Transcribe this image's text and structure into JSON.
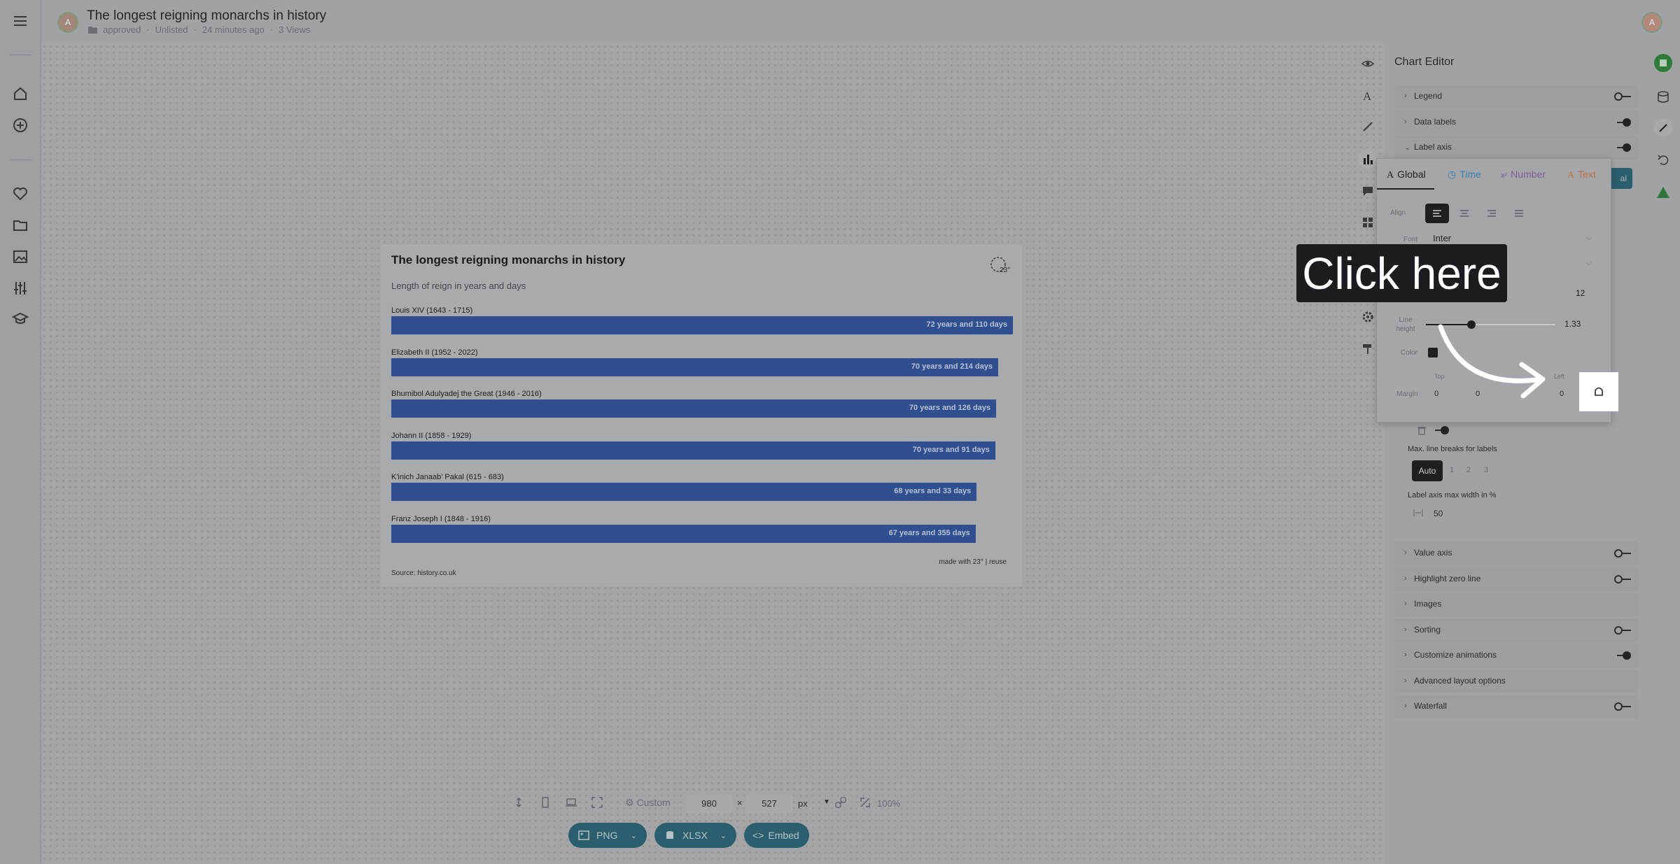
{
  "header": {
    "title": "The longest reigning monarchs in history",
    "folder": "approved",
    "visibility": "Unlisted",
    "updated": "24 minutes ago",
    "views": "3 Views",
    "avatar_letter": "A"
  },
  "chart": {
    "title": "The longest reigning monarchs in history",
    "subtitle": "Length of reign in years and days",
    "source": "Source: history.co.uk",
    "made_with": "made with 23° | reuse",
    "logo_text": "23°"
  },
  "chart_data": {
    "type": "bar",
    "orientation": "horizontal",
    "categories": [
      "Louis XIV (1643 - 1715)",
      "Elizabeth II (1952 - 2022)",
      "Bhumibol Adulyadej the Great (1946 - 2016)",
      "Johann II (1858 - 1929)",
      "K'inich Janaab' Pakal (615 - 683)",
      "Franz Joseph I (1848 - 1916)"
    ],
    "values": [
      72.3,
      70.59,
      70.35,
      70.25,
      68.09,
      67.97
    ],
    "data_labels": [
      "72 years and 110 days",
      "70 years and 214 days",
      "70 years and 126 days",
      "70 years and 91 days",
      "68 years and 33 days",
      "67 years and 355 days"
    ],
    "title": "The longest reigning monarchs in history",
    "subtitle": "Length of reign in years and days",
    "bar_color": "#2f4f8f",
    "grid": false,
    "legend": false
  },
  "editor": {
    "title": "Chart Editor",
    "sections_top": [
      {
        "label": "Legend",
        "on": false
      },
      {
        "label": "Data labels",
        "on": true
      },
      {
        "label": "Label axis",
        "on": true
      }
    ],
    "sections_bottom": [
      {
        "label": "Value axis",
        "on": false
      },
      {
        "label": "Highlight zero line",
        "on": false
      },
      {
        "label": "Images",
        "on": null
      },
      {
        "label": "Sorting",
        "on": false
      },
      {
        "label": "Customize animations",
        "on": true
      },
      {
        "label": "Advanced layout options",
        "on": null
      },
      {
        "label": "Waterfall",
        "on": false
      }
    ],
    "hidden_button": "al",
    "max_breaks_label": "Max. line breaks for labels",
    "max_breaks_options": [
      "Auto",
      "1",
      "2",
      "3"
    ],
    "max_breaks_selected": "Auto",
    "max_width_label": "Label axis max width in %",
    "max_width_value": "50"
  },
  "popup": {
    "tabs": [
      {
        "label": "Global",
        "color": "#1e1f21"
      },
      {
        "label": "Time",
        "color": "#3c7fae"
      },
      {
        "label": "Number",
        "color": "#7d5e98"
      },
      {
        "label": "Text",
        "color": "#c0723d"
      }
    ],
    "align_label": "Align",
    "font_label": "Font",
    "font_value": "Inter",
    "size_value": "12",
    "line_height_label": "Line height",
    "line_height_value": "1.33",
    "line_height_fraction": 0.35,
    "color_label": "Color",
    "color_value": "#1e1f21",
    "margin_label": "Margin",
    "margin_headers": [
      "Top",
      "",
      "",
      "Left"
    ],
    "margin_values": [
      "0",
      "0",
      "",
      "0"
    ]
  },
  "callout": {
    "text": "Click here"
  },
  "toolbar": {
    "preset": "Custom",
    "width": "980",
    "height": "527",
    "unit": "px",
    "zoom": "100%",
    "png": "PNG",
    "xlsx": "XLSX",
    "embed": "Embed"
  },
  "user_avatar_letter": "A",
  "colors": {
    "accent_green": "#2f7a3a",
    "bar": "#2f4f8f",
    "export_button": "#2b5f6d"
  }
}
